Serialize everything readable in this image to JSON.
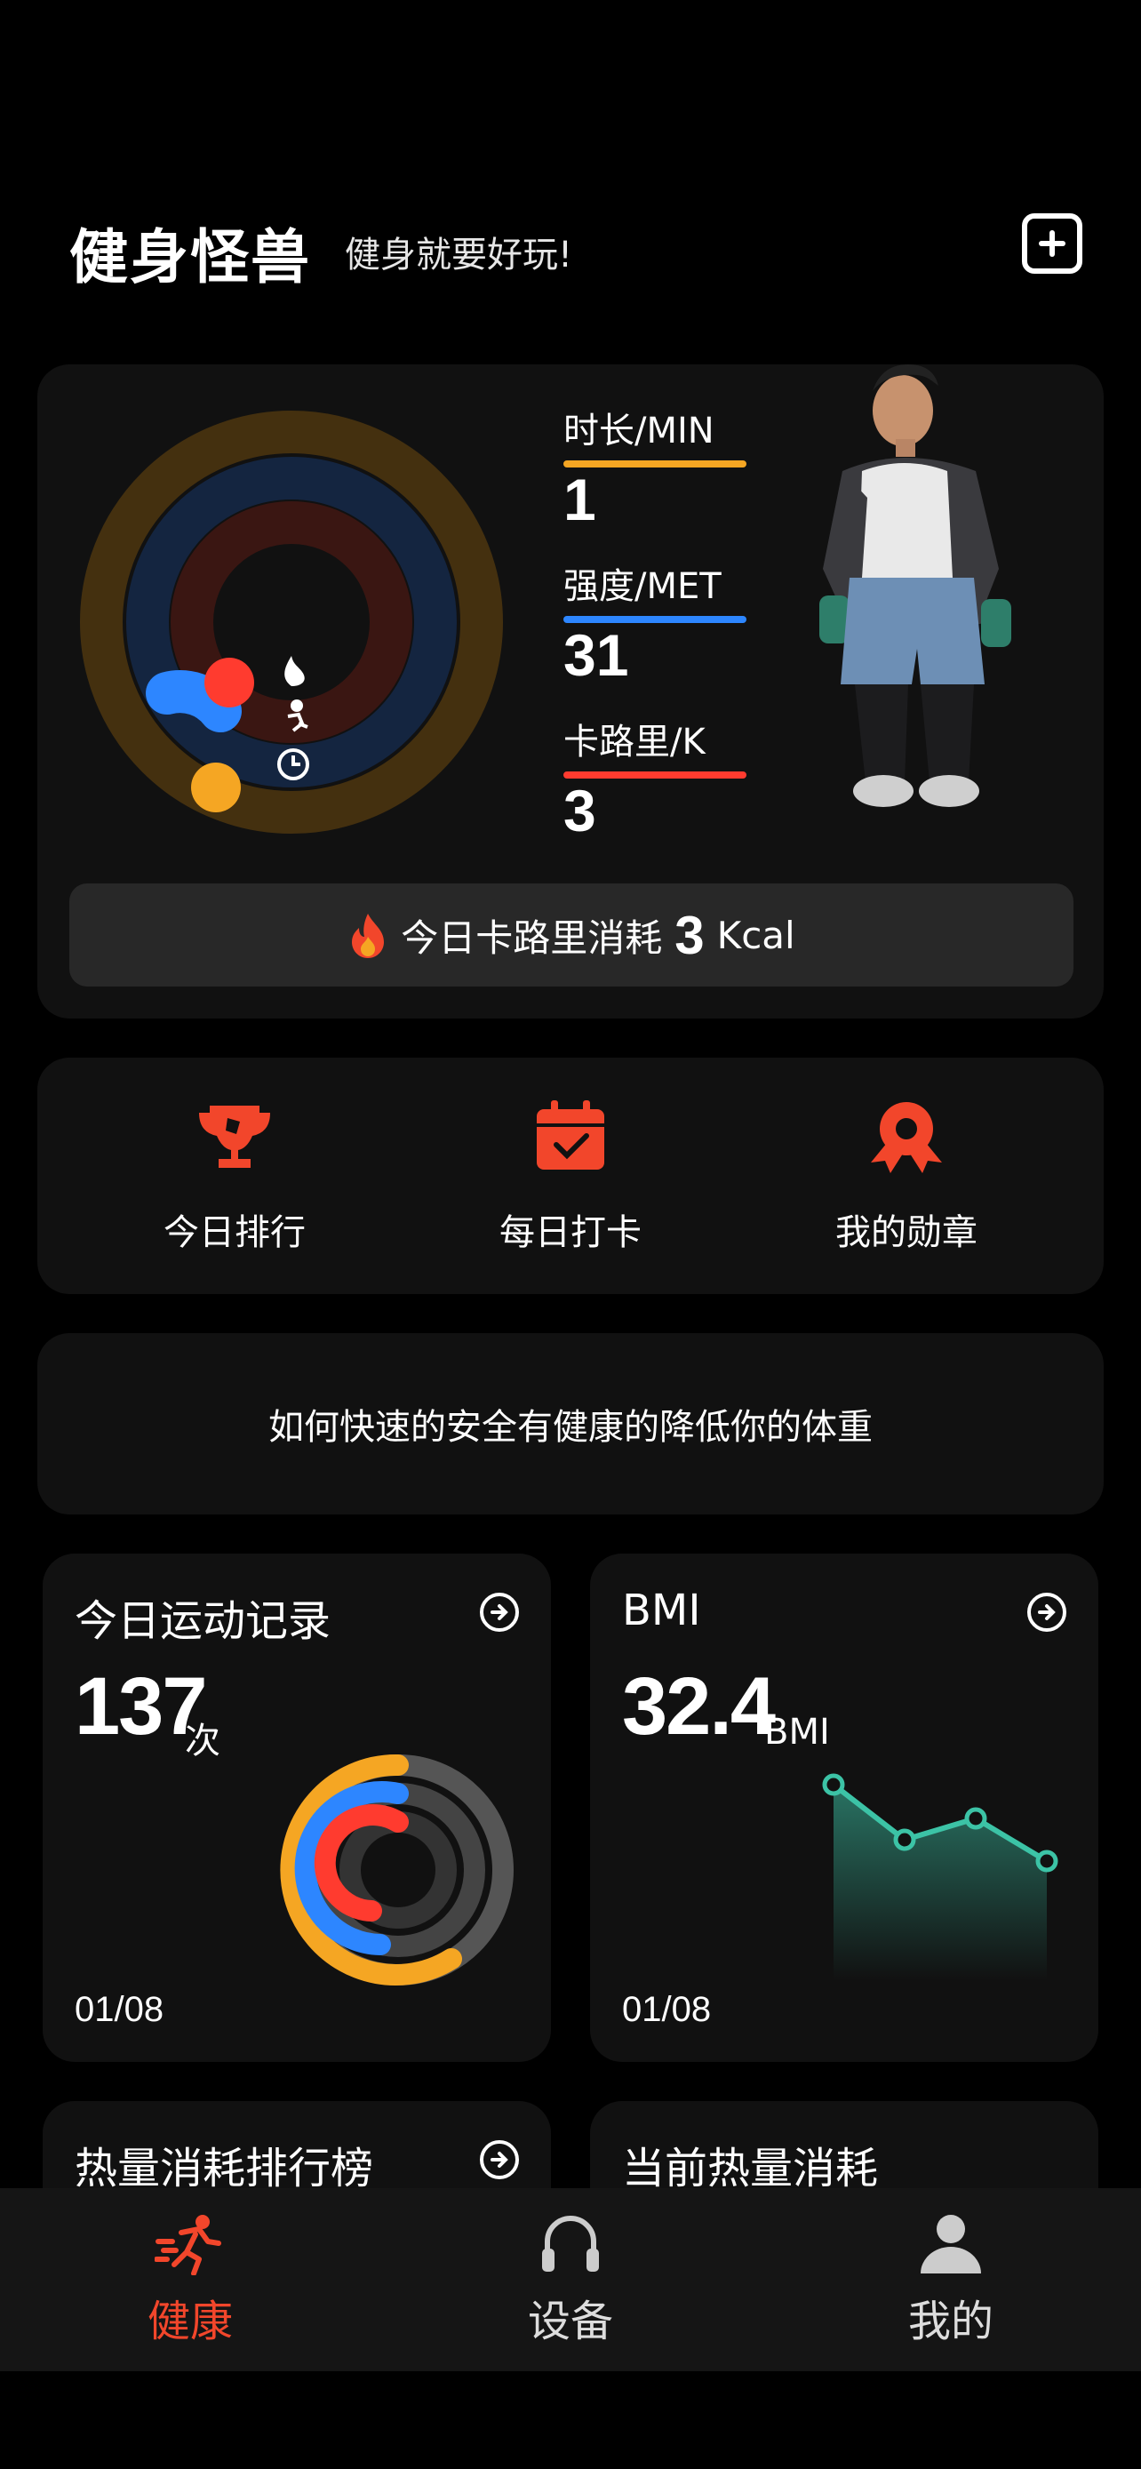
{
  "header": {
    "title": "健身怪兽",
    "slogan": "健身就要好玩!"
  },
  "summary": {
    "stats": [
      {
        "label": "时长/MIN",
        "value": "1",
        "color": "#f5a623"
      },
      {
        "label": "强度/MET",
        "value": "31",
        "color": "#2d86ff"
      },
      {
        "label": "卡路里/K",
        "value": "3",
        "color": "#ff3b2f"
      }
    ],
    "today_calorie": {
      "label": "今日卡路里消耗",
      "value": "3",
      "unit": "Kcal"
    }
  },
  "shortcuts": [
    {
      "label": "今日排行",
      "icon": "trophy-icon"
    },
    {
      "label": "每日打卡",
      "icon": "calendar-check-icon"
    },
    {
      "label": "我的勋章",
      "icon": "medal-icon"
    }
  ],
  "article": {
    "title": "如何快速的安全有健康的降低你的体重"
  },
  "tiles": {
    "exercise": {
      "title": "今日运动记录",
      "value": "137",
      "unit": "次",
      "date": "01/08"
    },
    "bmi": {
      "title": "BMI",
      "value": "32.4",
      "unit": "BMI",
      "date": "01/08"
    },
    "ranking": {
      "title": "热量消耗排行榜"
    },
    "current": {
      "title": "当前热量消耗"
    }
  },
  "tabbar": [
    {
      "label": "健康",
      "icon": "running-icon",
      "active": true
    },
    {
      "label": "设备",
      "icon": "headphones-icon",
      "active": false
    },
    {
      "label": "我的",
      "icon": "user-icon",
      "active": false
    }
  ],
  "colors": {
    "accent": "#f2462b",
    "orange": "#f5a623",
    "blue": "#2d86ff",
    "red": "#ff3b2f",
    "teal": "#3cc3a6"
  }
}
